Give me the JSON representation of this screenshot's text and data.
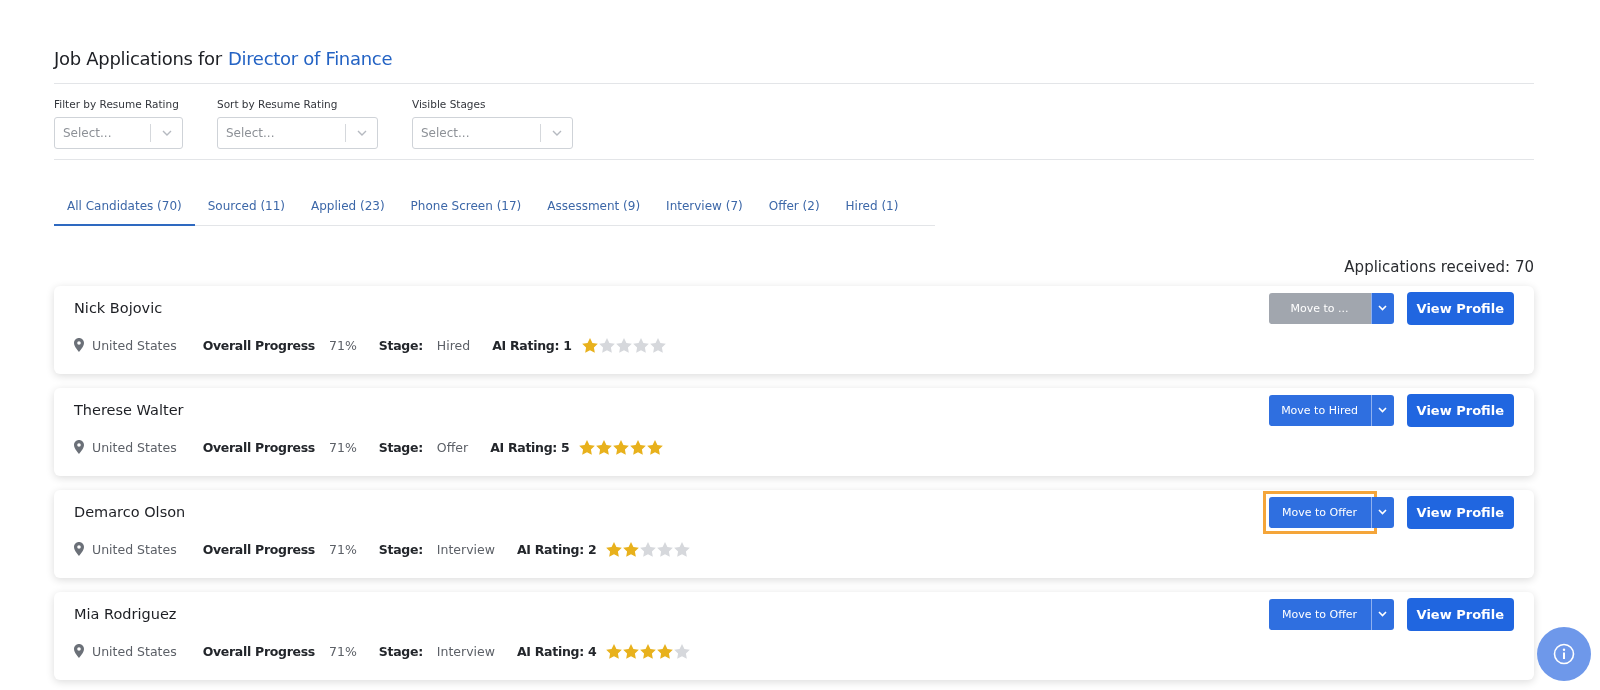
{
  "title": {
    "prefix": "Job Applications for",
    "job": "Director of Finance"
  },
  "filters": [
    {
      "label": "Filter by Resume Rating",
      "placeholder": "Select..."
    },
    {
      "label": "Sort by Resume Rating",
      "placeholder": "Select..."
    },
    {
      "label": "Visible Stages",
      "placeholder": "Select..."
    }
  ],
  "tabs": [
    {
      "label": "All Candidates (70)",
      "selected": true
    },
    {
      "label": "Sourced (11)",
      "selected": false
    },
    {
      "label": "Applied (23)",
      "selected": false
    },
    {
      "label": "Phone Screen (17)",
      "selected": false
    },
    {
      "label": "Assessment (9)",
      "selected": false
    },
    {
      "label": "Interview (7)",
      "selected": false
    },
    {
      "label": "Offer (2)",
      "selected": false
    },
    {
      "label": "Hired (1)",
      "selected": false
    }
  ],
  "applications_received": "Applications received: 70",
  "candidates": [
    {
      "name": "Nick Bojovic",
      "location": "United States",
      "progress_label": "Overall Progress",
      "progress": "71%",
      "stage_label": "Stage:",
      "stage": "Hired",
      "rating_label": "AI Rating: 1",
      "stars": 1,
      "move_label": "Move to ...",
      "move_disabled": true,
      "highlighted": false,
      "view_label": "View Profile"
    },
    {
      "name": "Therese Walter",
      "location": "United States",
      "progress_label": "Overall Progress",
      "progress": "71%",
      "stage_label": "Stage:",
      "stage": "Offer",
      "rating_label": "AI Rating: 5",
      "stars": 5,
      "move_label": "Move to Hired",
      "move_disabled": false,
      "highlighted": false,
      "view_label": "View Profile"
    },
    {
      "name": "Demarco Olson",
      "location": "United States",
      "progress_label": "Overall Progress",
      "progress": "71%",
      "stage_label": "Stage:",
      "stage": "Interview",
      "rating_label": "AI Rating: 2",
      "stars": 2,
      "move_label": "Move to Offer",
      "move_disabled": false,
      "highlighted": true,
      "view_label": "View Profile"
    },
    {
      "name": "Mia Rodriguez",
      "location": "United States",
      "progress_label": "Overall Progress",
      "progress": "71%",
      "stage_label": "Stage:",
      "stage": "Interview",
      "rating_label": "AI Rating: 4",
      "stars": 4,
      "move_label": "Move to Offer",
      "move_disabled": false,
      "highlighted": false,
      "view_label": "View Profile"
    }
  ]
}
